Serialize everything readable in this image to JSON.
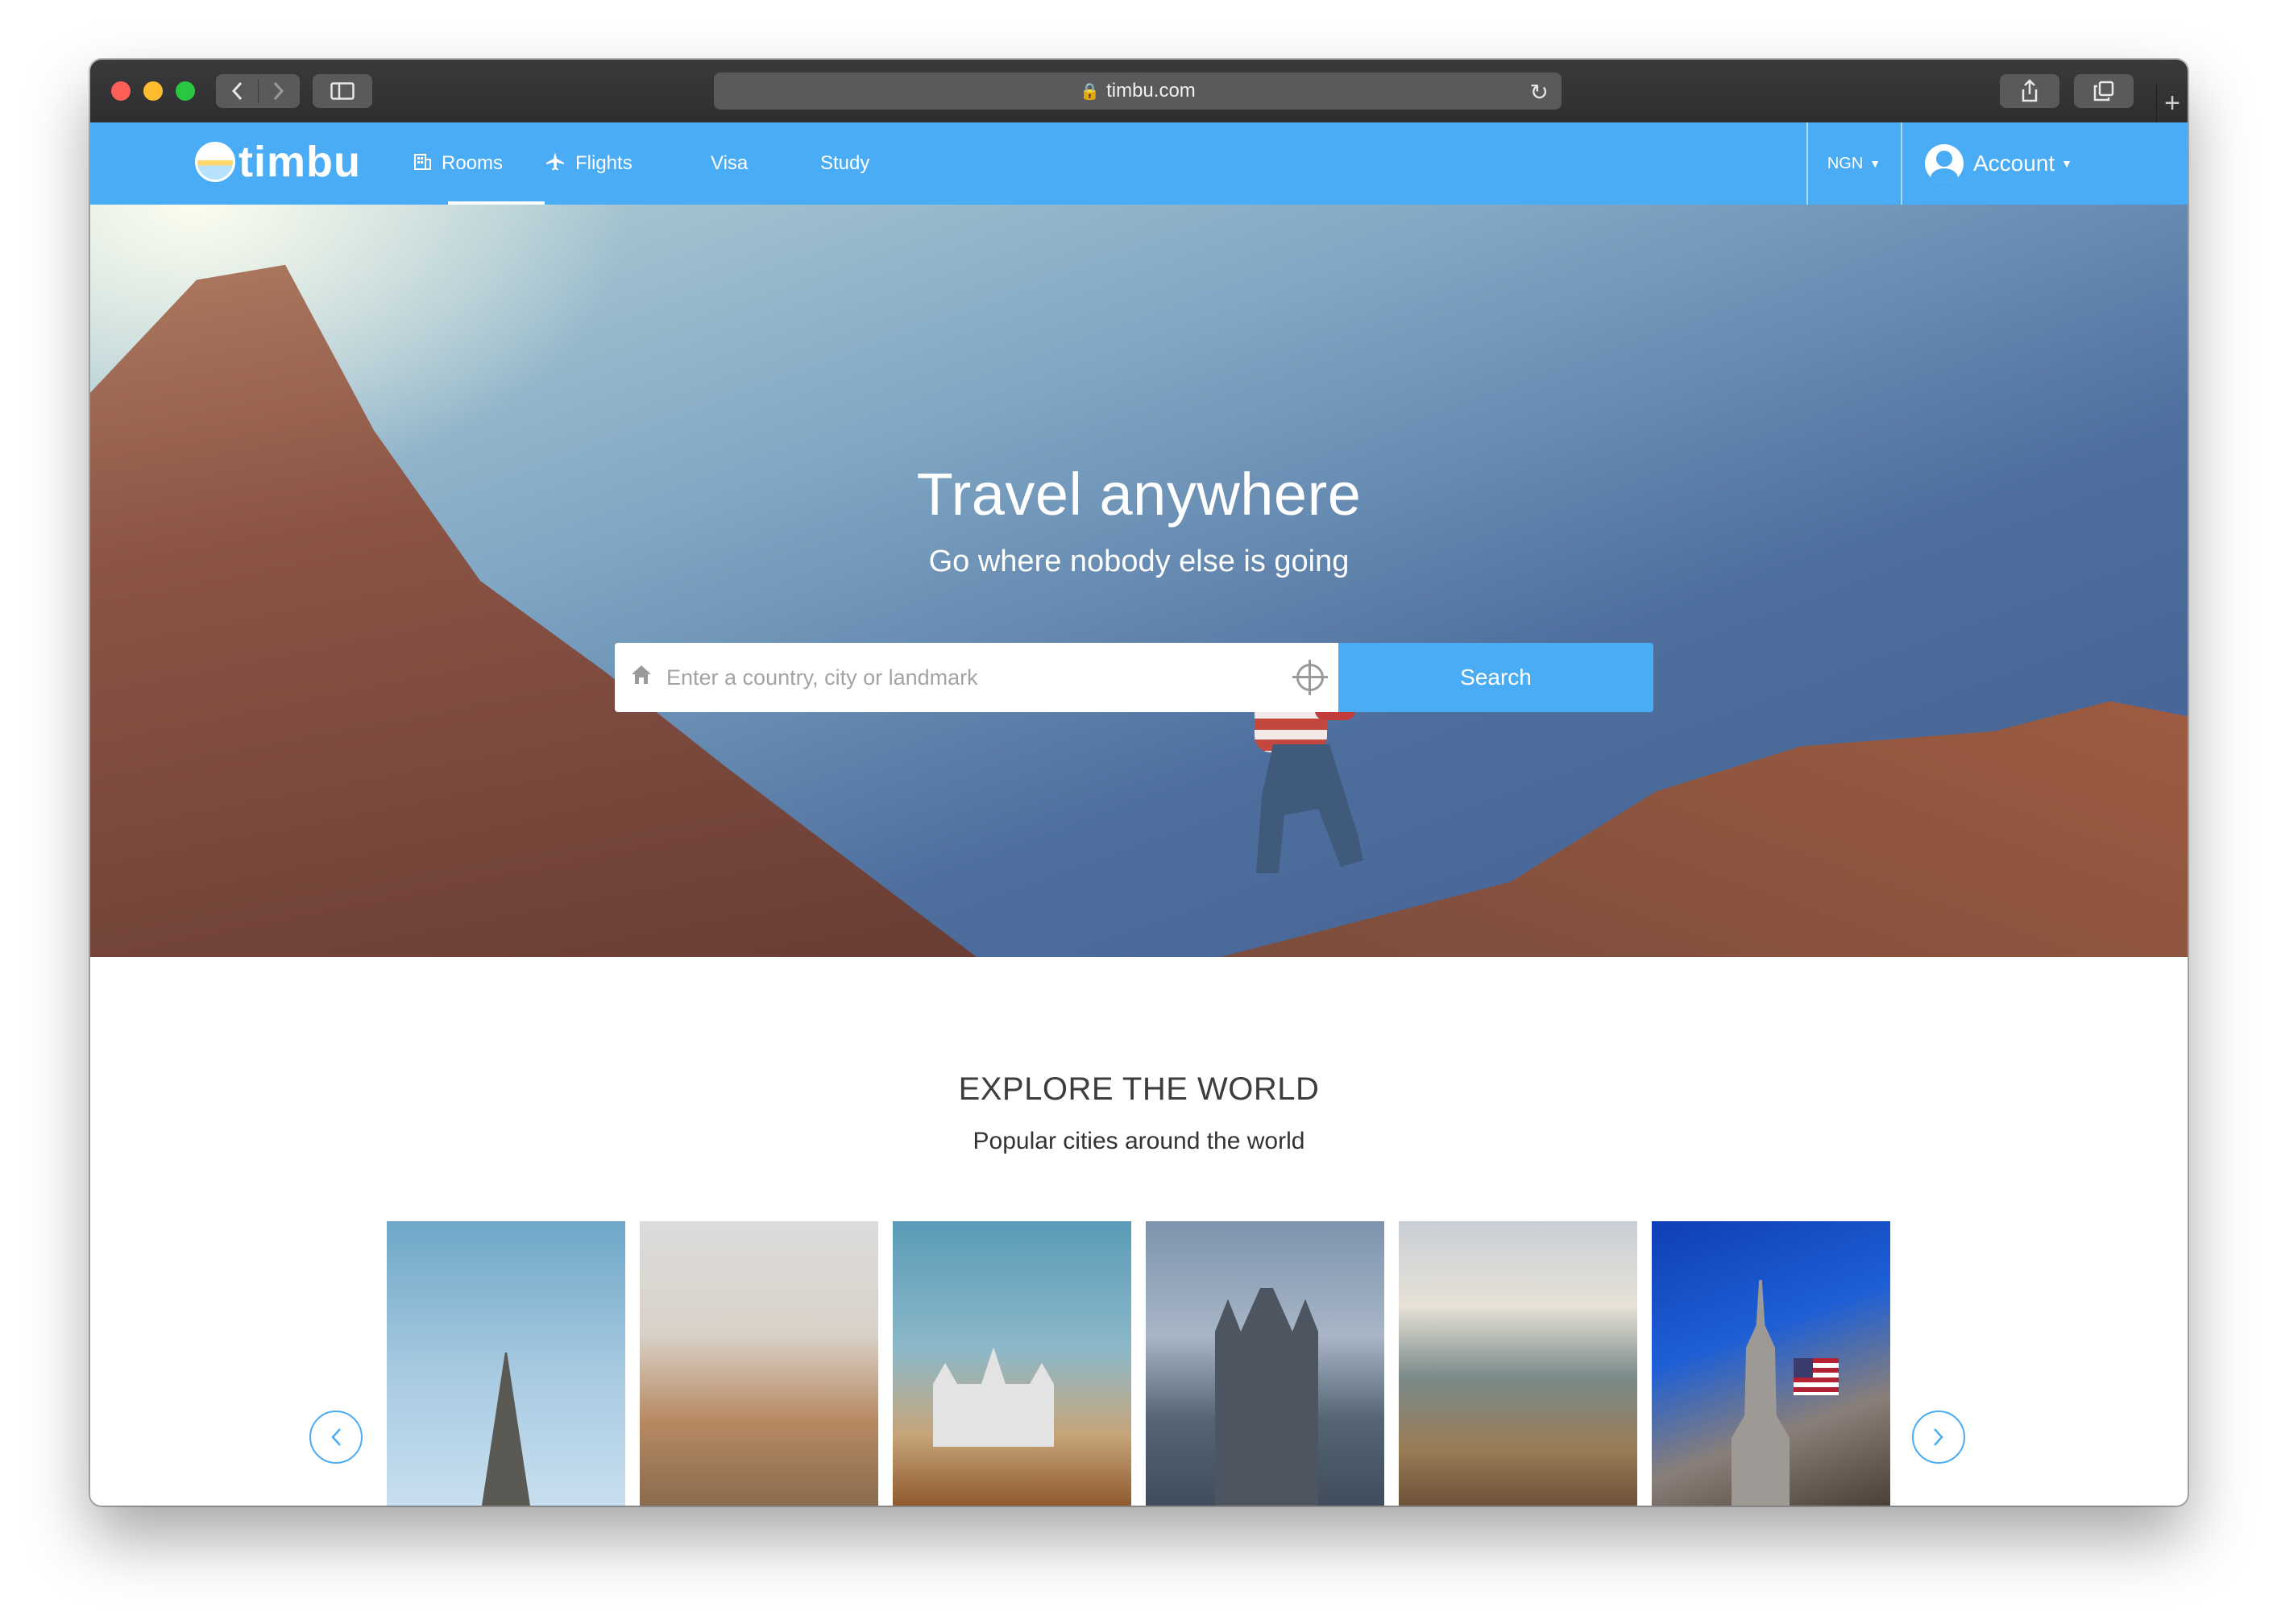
{
  "browser": {
    "url": "timbu.com"
  },
  "site": {
    "brand": "timbu",
    "nav": [
      {
        "label": "Rooms",
        "icon": "building-icon",
        "active": true
      },
      {
        "label": "Flights",
        "icon": "airplane-icon"
      },
      {
        "label": "Visa"
      },
      {
        "label": "Study"
      }
    ],
    "currency": "NGN",
    "account_label": "Account"
  },
  "hero": {
    "title": "Travel anywhere",
    "subtitle": "Go where nobody else is going",
    "search_placeholder": "Enter a country, city or landmark",
    "search_button": "Search"
  },
  "explore": {
    "title": "EXPLORE THE WORLD",
    "subtitle": "Popular cities around the world",
    "cards": [
      {
        "scene": "eiffel-tower"
      },
      {
        "scene": "old-town-river"
      },
      {
        "scene": "castle"
      },
      {
        "scene": "tower-bridge"
      },
      {
        "scene": "coastal-city"
      },
      {
        "scene": "empire-state-building"
      }
    ]
  },
  "colors": {
    "brand_blue": "#4aacf5"
  }
}
